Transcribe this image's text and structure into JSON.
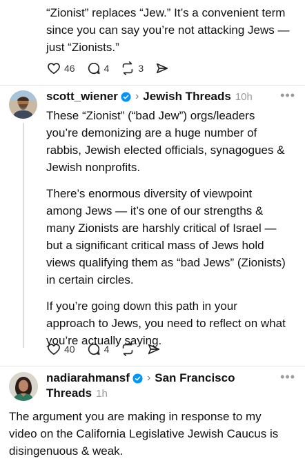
{
  "post1": {
    "text_lines": [
      "“Zionist” replaces “Jew.” It’s a convenient term",
      "since you can say you’re not attacking Jews —",
      "just “Zionists.”"
    ],
    "likes": "46",
    "replies": "4",
    "reposts": "3"
  },
  "post2": {
    "username": "scott_wiener",
    "topic": "Jewish Threads",
    "time": "10h",
    "paragraphs": [
      [
        "These “Zionist” (“bad Jew”) orgs/leaders",
        "you’re demonizing are a huge number of",
        "rabbis, Jewish elected officials, synagogues &",
        "Jewish nonprofits."
      ],
      [
        "There’s enormous diversity of viewpoint",
        "among Jews — it’s one of our strengths &",
        "many Zionists are harshly critical of Israel —",
        "but a significant critical mass of Jews hold",
        "views qualifying them as “bad Jews” (Zionists)",
        "in certain circles."
      ],
      [
        "If you’re going down this path in your",
        "approach to Jews, you need to reflect on what",
        "you’re actually saying."
      ]
    ],
    "likes": "40",
    "replies": "4"
  },
  "post3": {
    "username": "nadiarahmansf",
    "topic": "San Francisco",
    "topic_line2": "Threads",
    "time": "1h",
    "text_lines": [
      "The argument you are making in response to my",
      "video on the California Legislative Jewish Caucus is",
      "disingenuous & weak."
    ]
  },
  "icons": {
    "like": "heart-icon",
    "reply": "comment-icon",
    "repost": "repost-icon",
    "share": "share-icon",
    "more": "more-icon",
    "verified": "verified-badge-icon"
  },
  "colors": {
    "verified": "#0095f6",
    "muted": "#999999"
  }
}
